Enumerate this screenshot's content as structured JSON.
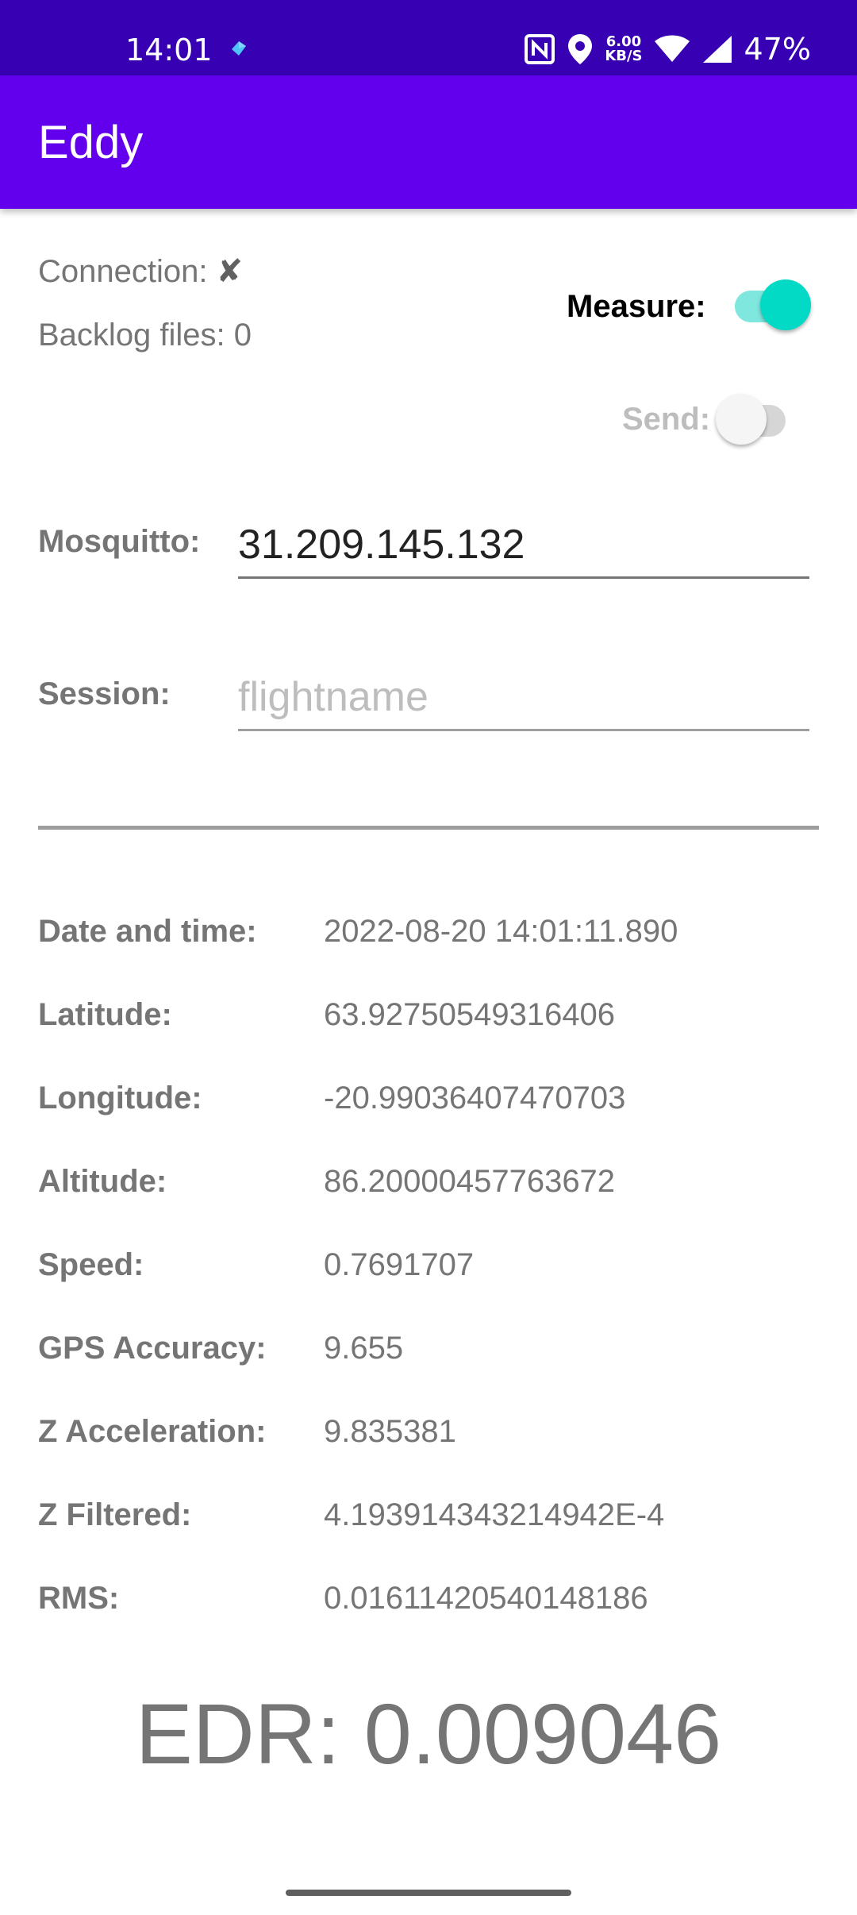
{
  "status": {
    "time": "14:01",
    "speed_value": "6.00",
    "speed_unit": "KB/S",
    "battery": "47%"
  },
  "app": {
    "title": "Eddy"
  },
  "connection": {
    "label": "Connection:",
    "state_icon": "✘"
  },
  "backlog": {
    "text": "Backlog files: 0"
  },
  "measure": {
    "label": "Measure:",
    "on": true
  },
  "send": {
    "label": "Send:",
    "on": false
  },
  "mosquitto": {
    "label": "Mosquitto:",
    "value": "31.209.145.132"
  },
  "session": {
    "label": "Session:",
    "value": "",
    "placeholder": "flightname"
  },
  "readings": [
    {
      "label": "Date and time:",
      "value": "2022-08-20 14:01:11.890"
    },
    {
      "label": "Latitude:",
      "value": "63.92750549316406"
    },
    {
      "label": "Longitude:",
      "value": "-20.99036407470703"
    },
    {
      "label": "Altitude:",
      "value": "86.20000457763672"
    },
    {
      "label": "Speed:",
      "value": "0.7691707"
    },
    {
      "label": "GPS Accuracy:",
      "value": "9.655"
    },
    {
      "label": "Z Acceleration:",
      "value": "9.835381"
    },
    {
      "label": "Z Filtered:",
      "value": "4.193914343214942E-4"
    },
    {
      "label": "RMS:",
      "value": "0.01611420540148186"
    }
  ],
  "edr": {
    "text": "EDR: 0.009046"
  },
  "colors": {
    "status_bar": "#3700b3",
    "app_bar": "#6200ee",
    "switch_on_thumb": "#03dac5",
    "switch_on_track": "#7fe7dd"
  }
}
